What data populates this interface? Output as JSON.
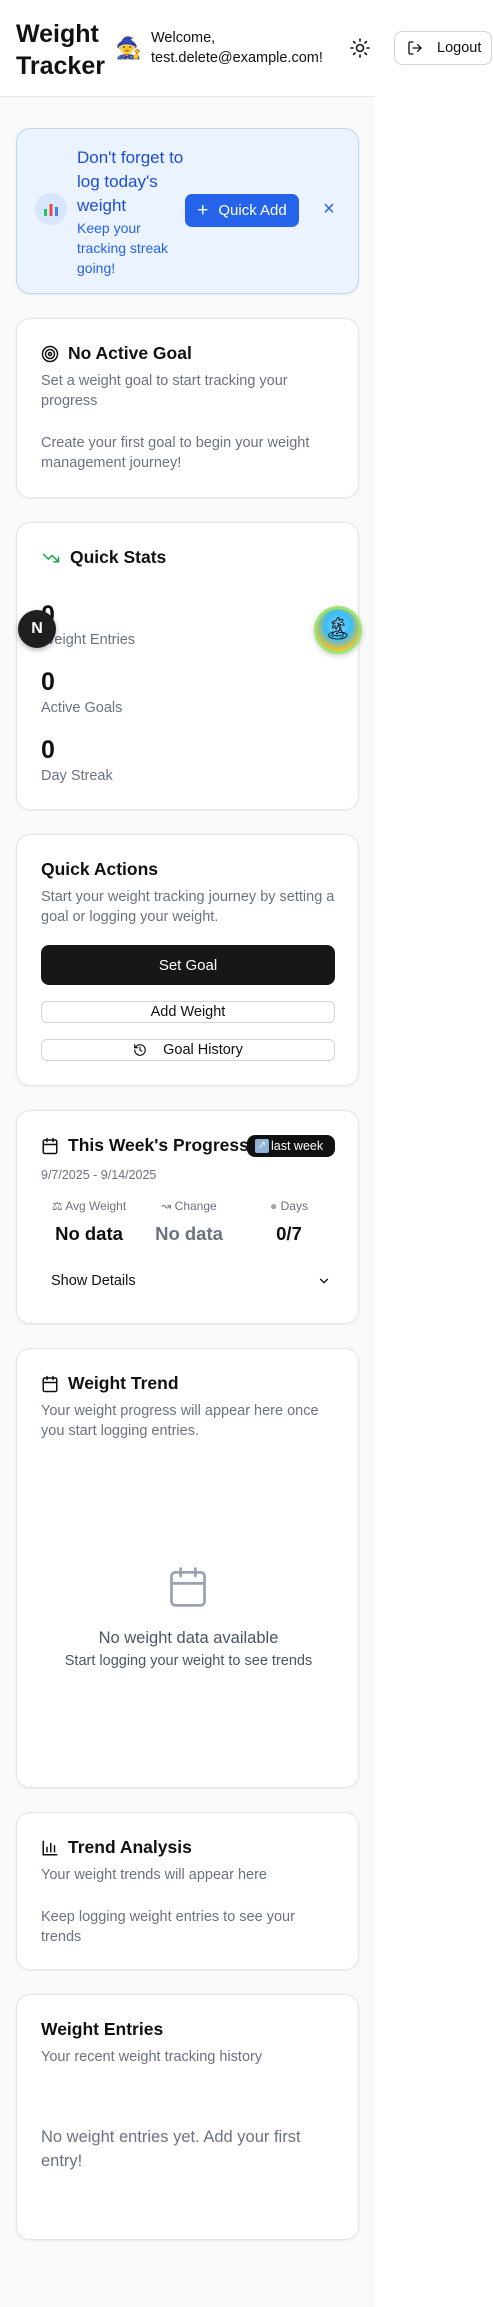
{
  "header": {
    "app_title": "Weight Tracker",
    "welcome": "Welcome, test.delete@example.com!",
    "logout_label": "Logout",
    "avatar_icon": "avatar-icon",
    "theme_icon": "sun-icon"
  },
  "reminder": {
    "title": "Don't forget to log today's weight",
    "subtitle": "Keep your tracking streak going!",
    "quick_add_label": "Quick Add",
    "close_symbol": "×"
  },
  "goal": {
    "title": "No Active Goal",
    "description": "Set a weight goal to start tracking your progress",
    "prompt": "Create your first goal to begin your weight management journey!"
  },
  "quick_stats": {
    "title": "Quick Stats",
    "stats": [
      {
        "value": "0",
        "label": "Weight Entries"
      },
      {
        "value": "0",
        "label": "Active Goals"
      },
      {
        "value": "0",
        "label": "Day Streak"
      }
    ]
  },
  "floating": {
    "n_badge": "N",
    "island_icon": "🏝"
  },
  "quick_actions": {
    "title": "Quick Actions",
    "description": "Start your weight tracking journey by setting a goal or logging your weight.",
    "set_goal_label": "Set Goal",
    "add_weight_label": "Add Weight",
    "goal_history_label": "Goal History"
  },
  "progress": {
    "title": "This Week's Progress",
    "badge": "last week",
    "date_range": "9/7/2025 - 9/14/2025",
    "metrics": [
      {
        "label": "Avg Weight",
        "value": "No data"
      },
      {
        "label": "Change",
        "value": "No data"
      },
      {
        "label": "Days",
        "value": "0/7"
      }
    ],
    "details_label": "Show Details"
  },
  "trend": {
    "title": "Weight Trend",
    "description": "Your weight progress will appear here once you start logging entries.",
    "empty_title": "No weight data available",
    "empty_subtitle": "Start logging your weight to see trends"
  },
  "analysis": {
    "title": "Trend Analysis",
    "description": "Your weight trends will appear here",
    "prompt": "Keep logging weight entries to see your trends"
  },
  "entries": {
    "title": "Weight Entries",
    "description": "Your recent weight tracking history",
    "empty": "No weight entries yet. Add your first entry!"
  },
  "colors": {
    "primary": "#2563eb",
    "dark_button": "#171717",
    "reminder_bg": "#eaf3ff",
    "trend_green": "#16a34a"
  }
}
